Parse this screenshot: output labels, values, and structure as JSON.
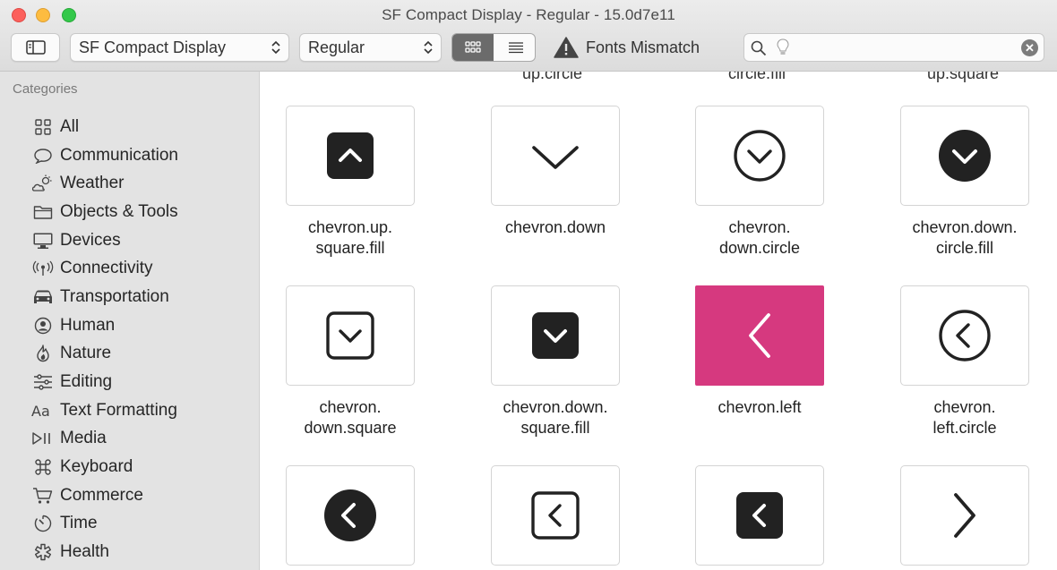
{
  "window": {
    "title": "SF Compact Display - Regular - 15.0d7e11"
  },
  "toolbar": {
    "font_family": "SF Compact Display",
    "font_style": "Regular",
    "mismatch_label": "Fonts Mismatch",
    "search_value": ""
  },
  "sidebar": {
    "header": "Categories",
    "items": [
      {
        "label": "All",
        "icon": "grid-icon"
      },
      {
        "label": "Communication",
        "icon": "speech-bubble-icon"
      },
      {
        "label": "Weather",
        "icon": "cloud-sun-icon"
      },
      {
        "label": "Objects & Tools",
        "icon": "folder-icon"
      },
      {
        "label": "Devices",
        "icon": "display-icon"
      },
      {
        "label": "Connectivity",
        "icon": "antenna-icon"
      },
      {
        "label": "Transportation",
        "icon": "car-icon"
      },
      {
        "label": "Human",
        "icon": "person-circle-icon"
      },
      {
        "label": "Nature",
        "icon": "flame-icon"
      },
      {
        "label": "Editing",
        "icon": "sliders-icon"
      },
      {
        "label": "Text Formatting",
        "icon": "textformat-icon"
      },
      {
        "label": "Media",
        "icon": "playpause-icon"
      },
      {
        "label": "Keyboard",
        "icon": "command-icon"
      },
      {
        "label": "Commerce",
        "icon": "cart-icon"
      },
      {
        "label": "Time",
        "icon": "timer-icon"
      },
      {
        "label": "Health",
        "icon": "staroflife-icon"
      }
    ]
  },
  "grid": {
    "partial_top": [
      "up.circle",
      "circle.fill",
      "up.square"
    ],
    "symbols": [
      {
        "name": "chevron.up.\nsquare.fill",
        "icon": "chevron-up-square-fill-icon"
      },
      {
        "name": "chevron.down",
        "icon": "chevron-down-icon"
      },
      {
        "name": "chevron.\ndown.circle",
        "icon": "chevron-down-circle-icon"
      },
      {
        "name": "chevron.down.\ncircle.fill",
        "icon": "chevron-down-circle-fill-icon"
      },
      {
        "name": "chevron.\ndown.square",
        "icon": "chevron-down-square-icon"
      },
      {
        "name": "chevron.down.\nsquare.fill",
        "icon": "chevron-down-square-fill-icon"
      },
      {
        "name": "chevron.left",
        "icon": "chevron-left-icon",
        "selected": true
      },
      {
        "name": "chevron.\nleft.circle",
        "icon": "chevron-left-circle-icon"
      },
      {
        "name": "",
        "icon": "chevron-left-circle-fill-icon"
      },
      {
        "name": "",
        "icon": "chevron-left-square-icon"
      },
      {
        "name": "",
        "icon": "chevron-left-square-fill-icon"
      },
      {
        "name": "",
        "icon": "chevron-right-icon"
      }
    ]
  },
  "colors": {
    "selection": "#d6397f",
    "sidebar_bg": "#e3e3e3",
    "glyph": "#222222"
  }
}
